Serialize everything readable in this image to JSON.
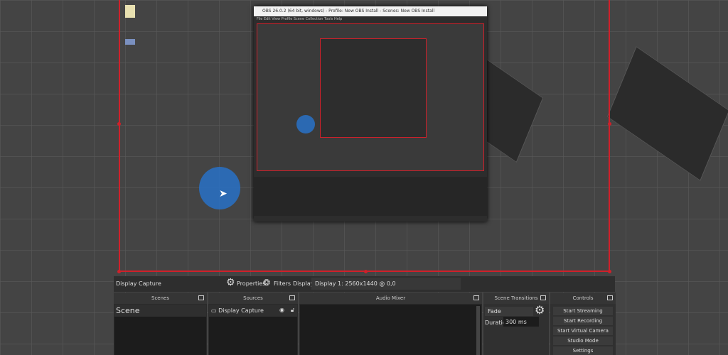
{
  "nested_window": {
    "title": "OBS 26.0.2 (64 bit, windows) - Profile: New OBS Install - Scenes: New OBS Install",
    "menu": [
      "File",
      "Edit",
      "View",
      "Profile",
      "Scene Collection",
      "Tools",
      "Help"
    ]
  },
  "source_toolbar": {
    "source_name": "Display Capture",
    "properties_label": "Properties",
    "filters_label": "Filters",
    "display_label": "Display",
    "display_value": "Display 1: 2560x1440 @ 0,0"
  },
  "scenes": {
    "header": "Scenes",
    "items": [
      "Scene"
    ]
  },
  "sources": {
    "header": "Sources",
    "items": [
      {
        "name": "Display Capture"
      }
    ]
  },
  "audio_mixer": {
    "header": "Audio Mixer"
  },
  "transitions": {
    "header": "Scene Transitions",
    "transition": "Fade",
    "duration_label": "Duration",
    "duration_value": "300 ms"
  },
  "controls": {
    "header": "Controls",
    "buttons": [
      "Start Streaming",
      "Start Recording",
      "Start Virtual Camera",
      "Studio Mode",
      "Settings"
    ]
  },
  "colors": {
    "selection": "#d0202a",
    "cursor_highlight": "#2a6fc0"
  }
}
